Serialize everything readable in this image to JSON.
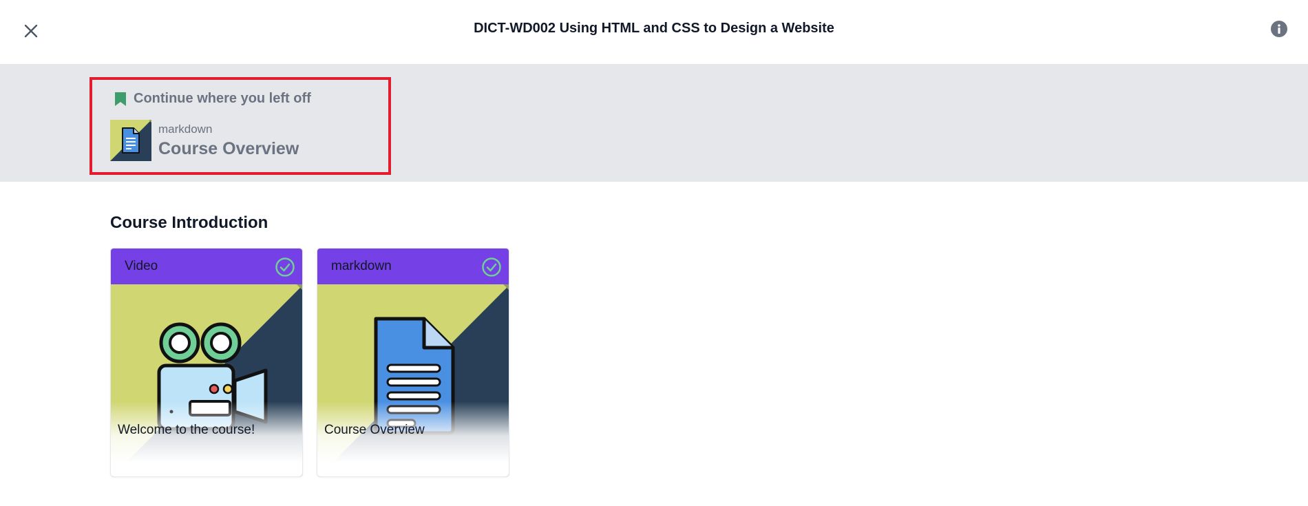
{
  "header": {
    "title": "DICT-WD002 Using HTML and CSS to Design a Website",
    "close_icon": "close-icon",
    "info_icon": "info-icon"
  },
  "resume": {
    "heading": "Continue where you left off",
    "bookmark_icon": "bookmark-icon",
    "item_type": "markdown",
    "item_title": "Course Overview"
  },
  "section": {
    "title": "Course Introduction",
    "cards": [
      {
        "type": "Video",
        "title": "Welcome to the course!",
        "icon": "video-camera-icon",
        "completed": true
      },
      {
        "type": "markdown",
        "title": "Course Overview",
        "icon": "document-icon",
        "completed": true
      }
    ]
  },
  "colors": {
    "accent_purple": "#7540e6",
    "highlight_red": "#e11d2e",
    "check_green": "#6fcf97",
    "bookmark_green": "#3f9d6c",
    "art_yellow": "#d0d672",
    "art_navy": "#283f57"
  }
}
